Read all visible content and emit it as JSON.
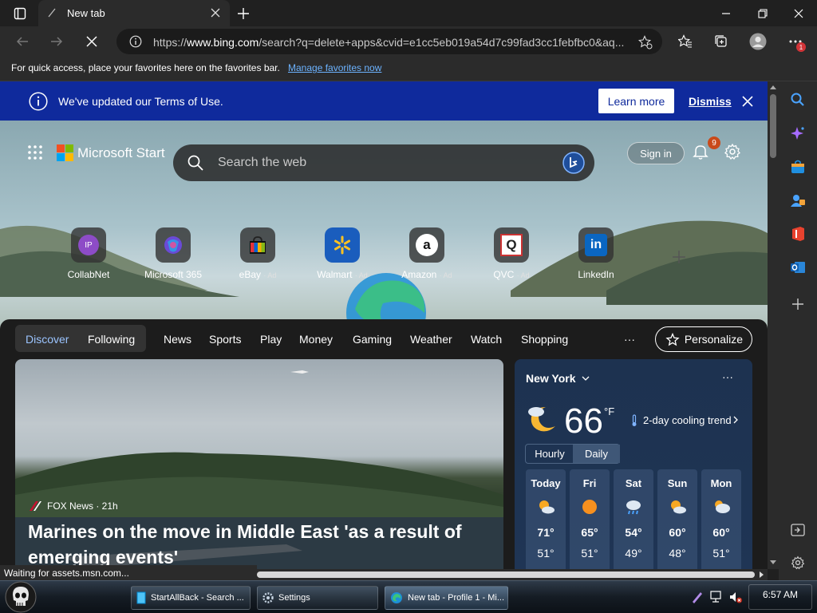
{
  "browser": {
    "tab_title": "New tab",
    "url_prefix": "https://",
    "url_host": "www.bing.com",
    "url_rest": "/search?q=delete+apps&cvid=e1cc5eb019a54d7c99fad3cc1febfbc0&aq...",
    "favorites_message": "For quick access, place your favorites here on the favorites bar.",
    "favorites_link": "Manage favorites now",
    "menu_badge": "1"
  },
  "terms": {
    "message": "We've updated our Terms of Use.",
    "learn_more": "Learn more",
    "dismiss": "Dismiss"
  },
  "start": {
    "brand": "Microsoft Start",
    "search_placeholder": "Search the web",
    "sign_in": "Sign in",
    "notification_count": "9"
  },
  "quick_links": [
    {
      "name": "CollabNet",
      "ad": "",
      "initials": "IP"
    },
    {
      "name": "Microsoft 365",
      "ad": ""
    },
    {
      "name": "eBay",
      "ad": "· Ad"
    },
    {
      "name": "Walmart",
      "ad": "· Ad"
    },
    {
      "name": "Amazon",
      "ad": "· Ad",
      "glyph": "a"
    },
    {
      "name": "QVC",
      "ad": "· Ad",
      "glyph": "Q"
    },
    {
      "name": "LinkedIn",
      "ad": "",
      "glyph": "in"
    }
  ],
  "feed": {
    "tabs": [
      "Discover",
      "Following"
    ],
    "nav": [
      "News",
      "Sports",
      "Play",
      "Money",
      "Gaming",
      "Weather",
      "Watch",
      "Shopping"
    ],
    "more": "···",
    "personalize": "Personalize"
  },
  "article": {
    "source": "FOX News · 21h",
    "headline": "Marines on the move in Middle East 'as a result of emerging events'"
  },
  "weather": {
    "city": "New York",
    "more": "···",
    "temp": "66",
    "unit": "°F",
    "trend": "2-day cooling trend",
    "toggle": [
      "Hourly",
      "Daily"
    ],
    "days": [
      {
        "name": "Today",
        "hi": "71°",
        "lo": "51°",
        "icon": "partly-sunny"
      },
      {
        "name": "Fri",
        "hi": "65°",
        "lo": "51°",
        "icon": "sunny"
      },
      {
        "name": "Sat",
        "hi": "54°",
        "lo": "49°",
        "icon": "rain"
      },
      {
        "name": "Sun",
        "hi": "60°",
        "lo": "48°",
        "icon": "partly-sunny"
      },
      {
        "name": "Mon",
        "hi": "60°",
        "lo": "51°",
        "icon": "mostly-cloudy"
      }
    ]
  },
  "status": "Waiting for assets.msn.com...",
  "taskbar": {
    "tasks": [
      "StartAllBack - Search ...",
      "Settings",
      "New tab - Profile 1 - Mi..."
    ],
    "clock": "6:57 AM"
  },
  "colors": {
    "terms_banner": "#0f2a9c",
    "accent_link": "#6cb3ff",
    "active_tab": "#9bc4ff"
  }
}
